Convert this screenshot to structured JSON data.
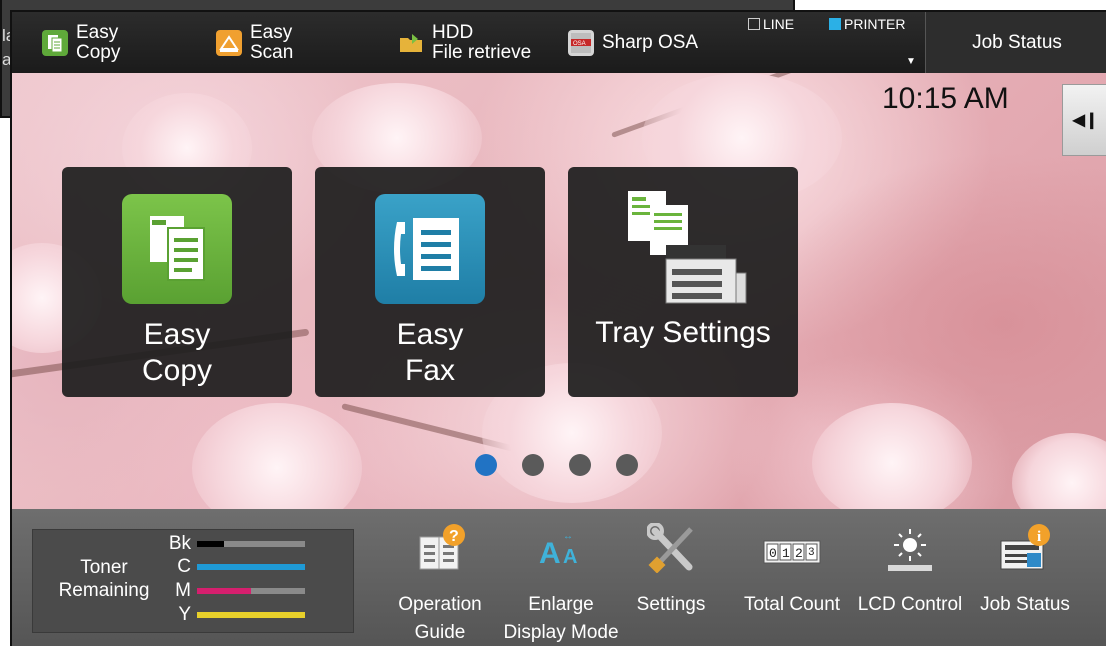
{
  "background_panel": {
    "fragment_text": "la\na"
  },
  "topbar": {
    "shortcuts": [
      {
        "label": "Easy\nCopy",
        "icon": "easy-copy-icon",
        "color": "#5fa93a"
      },
      {
        "label": "Easy\nScan",
        "icon": "easy-scan-icon",
        "color": "#f0a030"
      },
      {
        "label": "HDD\nFile retrieve",
        "icon": "folder-icon",
        "color": "#e6b33a"
      },
      {
        "label": "Sharp OSA",
        "icon": "sharp-osa-icon",
        "color": "#d5d5d5"
      }
    ],
    "indicators": [
      {
        "label": "LINE",
        "lit": false
      },
      {
        "label": "PRINTER",
        "lit": true,
        "color": "#2bb0e6"
      }
    ],
    "job_status_button": "Job Status"
  },
  "clock": "10:15 AM",
  "side_tab_icon": "collapse-left-icon",
  "tiles": [
    {
      "label": "Easy\nCopy",
      "icon": "copy-app-icon",
      "color": "#6ab43c"
    },
    {
      "label": "Easy\nFax",
      "icon": "fax-app-icon",
      "color": "#2a8cb4"
    },
    {
      "label": "Tray Settings",
      "icon": "tray-settings-icon"
    }
  ],
  "pager": {
    "pages": 4,
    "active_index": 0
  },
  "toner": {
    "title": "Toner\nRemaining",
    "levels": [
      {
        "label": "Bk",
        "level": 0.25,
        "color": "#000000"
      },
      {
        "label": "C",
        "level": 1.0,
        "color": "#1f9ad6"
      },
      {
        "label": "M",
        "level": 0.5,
        "color": "#d61f6e"
      },
      {
        "label": "Y",
        "level": 1.0,
        "color": "#e8d02a"
      }
    ]
  },
  "bottom_items": [
    {
      "label": "Operation\nGuide",
      "icon": "operation-guide-icon"
    },
    {
      "label": "Enlarge\nDisplay Mode",
      "icon": "enlarge-display-icon"
    },
    {
      "label": "Settings",
      "icon": "settings-icon"
    },
    {
      "label": "Total Count",
      "icon": "total-count-icon"
    },
    {
      "label": "LCD Control",
      "icon": "lcd-control-icon"
    },
    {
      "label": "Job Status",
      "icon": "job-status-icon"
    }
  ]
}
